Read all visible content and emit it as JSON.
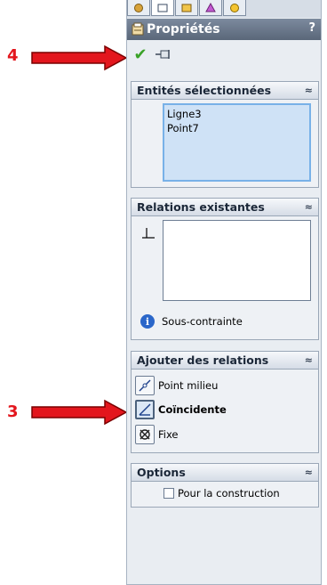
{
  "panel": {
    "title": "Propriétés",
    "help": "?",
    "ok_symbol": "✔"
  },
  "groups": {
    "selected": {
      "title": "Entités sélectionnées",
      "items": [
        "Ligne3",
        "Point7"
      ]
    },
    "existing": {
      "title": "Relations existantes",
      "status": "Sous-contrainte"
    },
    "add": {
      "title": "Ajouter des relations",
      "items": [
        "Point milieu",
        "Coïncidente",
        "Fixe"
      ]
    },
    "options": {
      "title": "Options",
      "checkbox_label": "Pour la construction"
    }
  },
  "callouts": {
    "top": "4",
    "bottom": "3"
  },
  "colors": {
    "arrow": "#e3161d",
    "ok": "#3aa228",
    "selection": "#cfe2f6"
  }
}
